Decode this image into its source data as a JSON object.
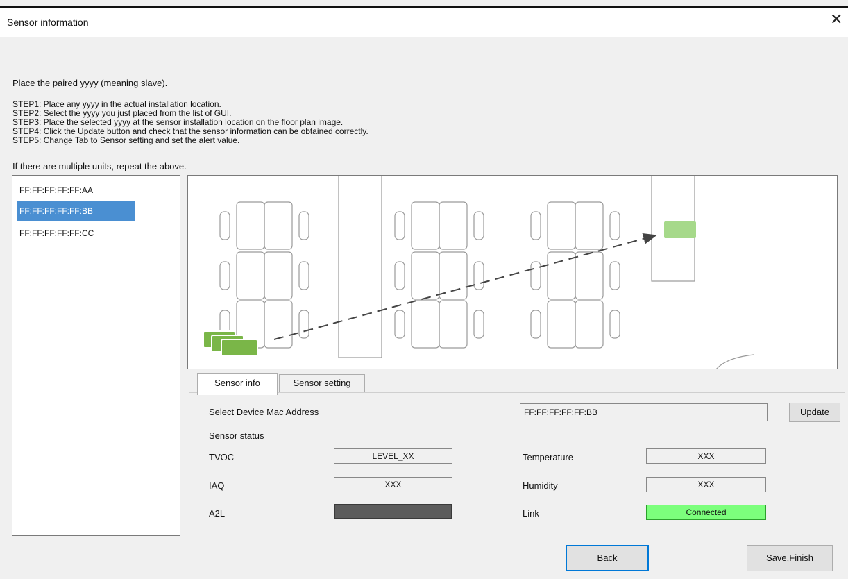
{
  "window": {
    "title": "Sensor information",
    "close_glyph": "✕"
  },
  "instructions": {
    "intro": "Place the paired yyyy (meaning slave).",
    "steps": [
      "STEP1: Place any yyyy in the actual installation location.",
      "STEP2: Select the yyyy you just placed from the list of GUI.",
      "STEP3: Place the selected yyyy at the sensor installation location on the floor plan image.",
      "STEP4: Click the Update button and check that the sensor information can be obtained correctly.",
      "STEP5: Change Tab to Sensor setting and set the alert value."
    ],
    "repeat": "If there are multiple units, repeat the above."
  },
  "device_list": {
    "items": [
      "FF:FF:FF:FF:FF:AA",
      "FF:FF:FF:FF:FF:BB",
      "FF:FF:FF:FF:FF:CC"
    ],
    "selected_index": 1
  },
  "tabs": [
    {
      "label": "Sensor info",
      "active": true
    },
    {
      "label": "Sensor setting",
      "active": false
    }
  ],
  "sensor_info": {
    "mac_label": "Select Device Mac Address",
    "mac_value": "FF:FF:FF:FF:FF:BB",
    "update_label": "Update",
    "status_label": "Sensor status",
    "tvoc_label": "TVOC",
    "tvoc_value": "LEVEL_XX",
    "iaq_label": "IAQ",
    "iaq_value": "XXX",
    "a2l_label": "A2L",
    "temperature_label": "Temperature",
    "temperature_value": "XXX",
    "humidity_label": "Humidity",
    "humidity_value": "XXX",
    "link_label": "Link",
    "link_value": "Connected"
  },
  "footer": {
    "back_label": "Back",
    "save_label": "Save,Finish"
  },
  "colors": {
    "selection": "#4a8fd2",
    "sensor_green": "#7ab648",
    "sensor_placed": "#a6d98a",
    "connected_green": "#7cff7c",
    "a2l_dark": "#5c5c5c",
    "focus_blue": "#0078d7"
  }
}
